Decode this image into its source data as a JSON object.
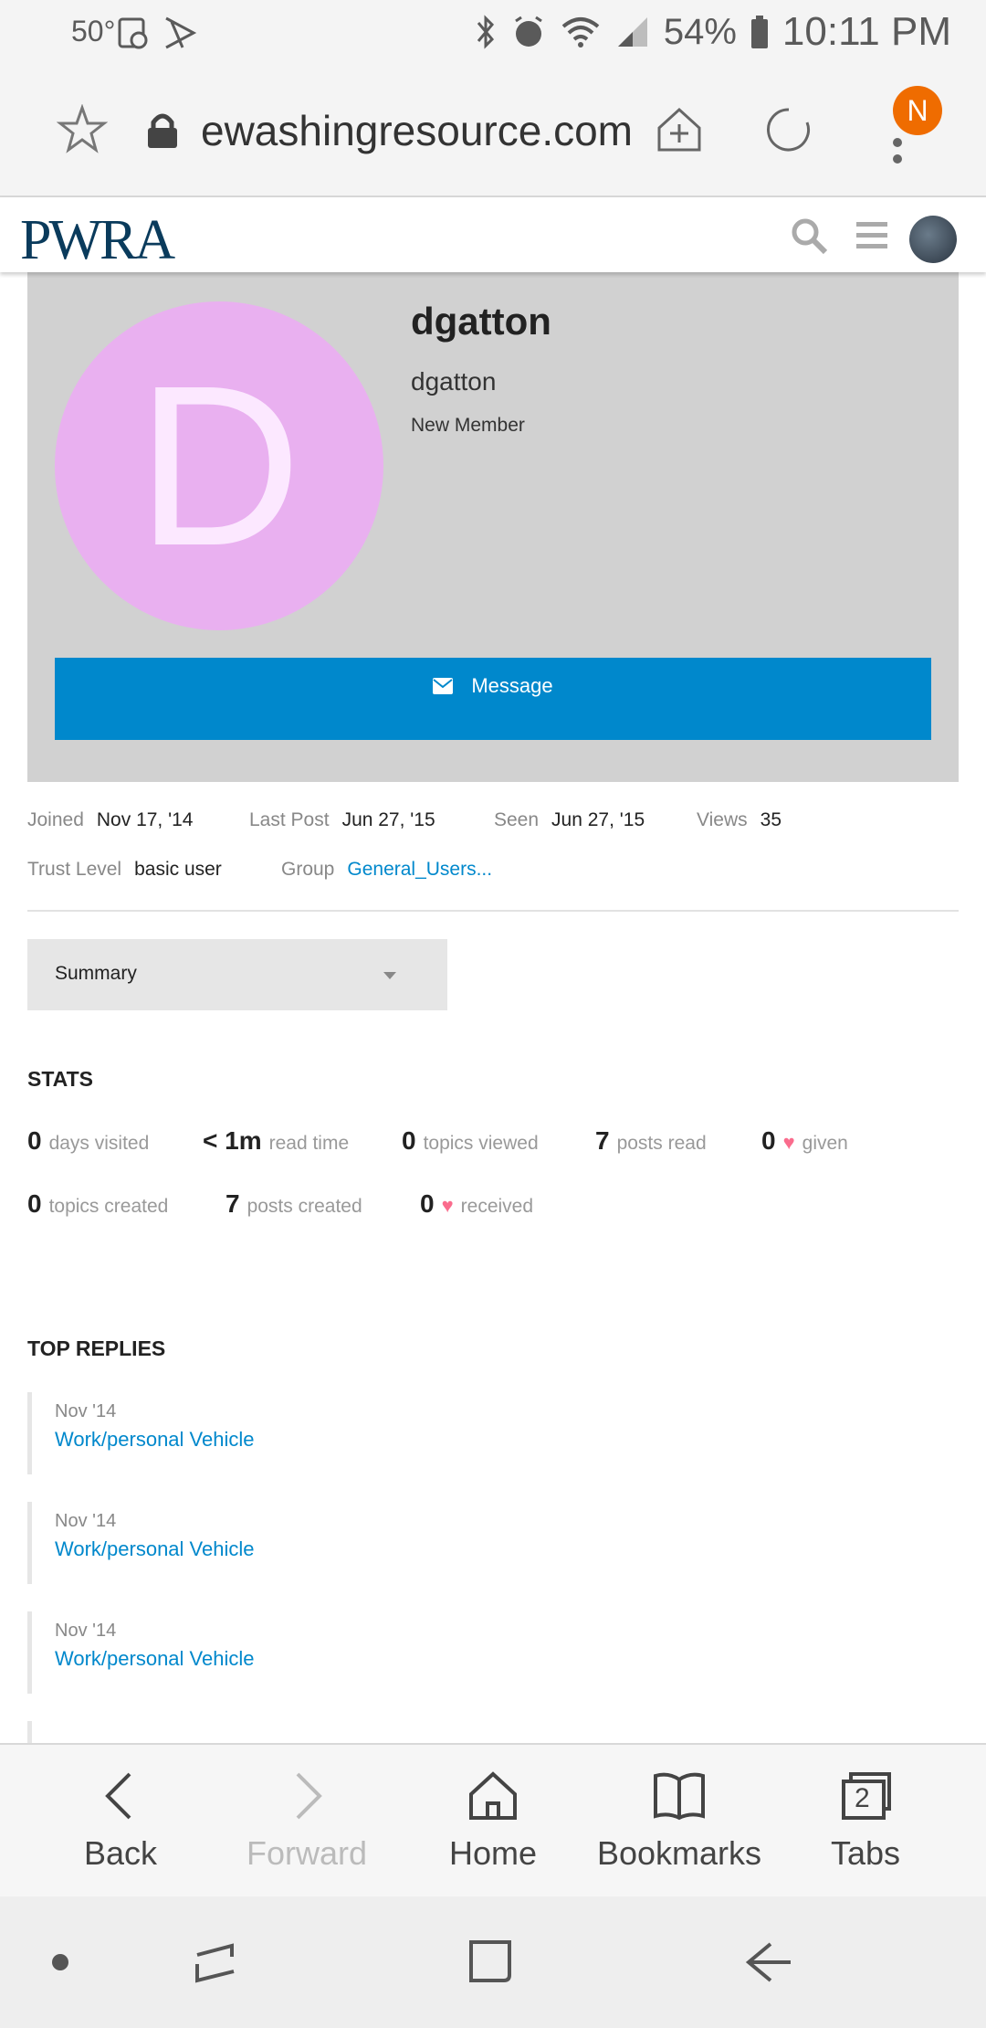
{
  "status_bar": {
    "temperature": "50°",
    "battery": "54%",
    "time": "10:11 PM"
  },
  "browser": {
    "url": "ewashingresource.com",
    "account_initial": "N"
  },
  "site": {
    "logo": "PWRA"
  },
  "profile": {
    "avatar_letter": "D",
    "avatar_color": "#e9b0f0",
    "username": "dgatton",
    "name": "dgatton",
    "title": "New Member",
    "message_label": "Message",
    "message_color": "#0088cc"
  },
  "details": {
    "joined_label": "Joined",
    "joined_value": "Nov 17, '14",
    "last_post_label": "Last Post",
    "last_post_value": "Jun 27, '15",
    "seen_label": "Seen",
    "seen_value": "Jun 27, '15",
    "views_label": "Views",
    "views_value": "35",
    "trust_label": "Trust Level",
    "trust_value": "basic user",
    "group_label": "Group",
    "group_value": "General_Users..."
  },
  "summary_dropdown": {
    "selected": "Summary"
  },
  "stats": {
    "title": "STATS",
    "days_visited_num": "0",
    "days_visited_txt": "days visited",
    "read_time_num": "< 1m",
    "read_time_txt": "read time",
    "topics_viewed_num": "0",
    "topics_viewed_txt": "topics viewed",
    "posts_read_num": "7",
    "posts_read_txt": "posts read",
    "given_num": "0",
    "given_txt": "given",
    "topics_created_num": "0",
    "topics_created_txt": "topics created",
    "posts_created_num": "7",
    "posts_created_txt": "posts created",
    "received_num": "0",
    "received_txt": "received"
  },
  "top_replies": {
    "title": "TOP REPLIES",
    "items": [
      {
        "date": "Nov '14",
        "title": "Work/personal Vehicle"
      },
      {
        "date": "Nov '14",
        "title": "Work/personal Vehicle"
      },
      {
        "date": "Nov '14",
        "title": "Work/personal Vehicle"
      }
    ]
  },
  "bottom_nav": {
    "back": "Back",
    "forward": "Forward",
    "home": "Home",
    "bookmarks": "Bookmarks",
    "tabs": "Tabs",
    "tab_count": "2"
  }
}
